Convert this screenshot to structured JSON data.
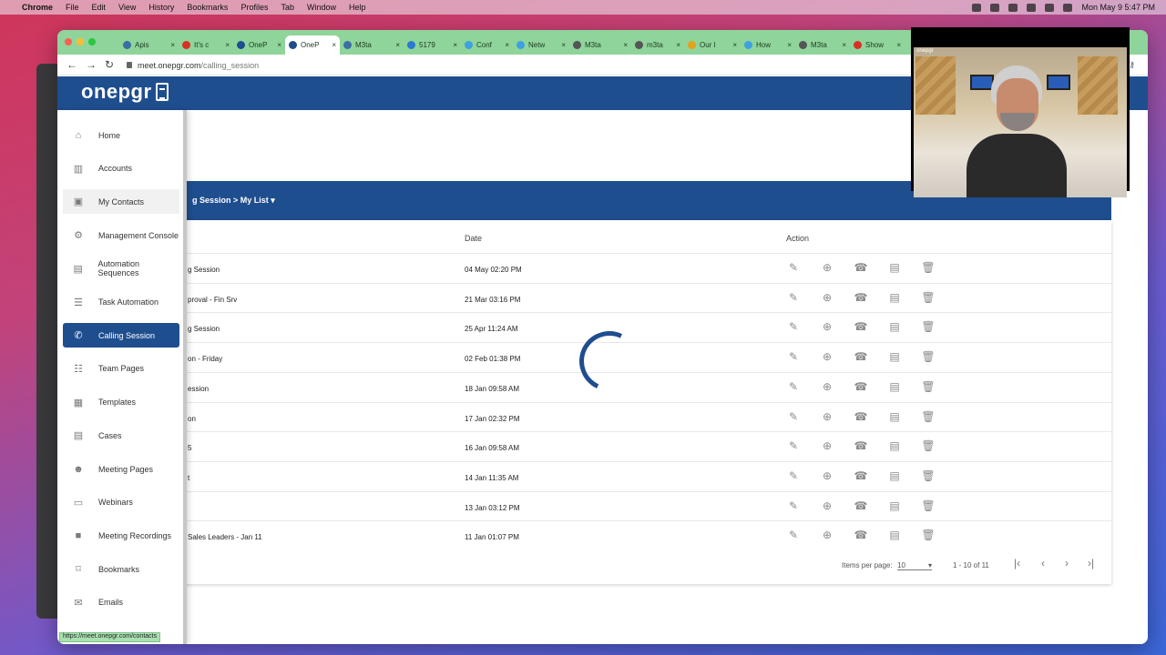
{
  "menubar": {
    "app": "Chrome",
    "items": [
      "File",
      "Edit",
      "View",
      "History",
      "Bookmarks",
      "Profiles",
      "Tab",
      "Window",
      "Help"
    ],
    "clock": "Mon May 9  5:47 PM"
  },
  "browser": {
    "tabs": [
      {
        "label": "Apis",
        "color": "#3b6ea5"
      },
      {
        "label": "It's c",
        "color": "#d93025"
      },
      {
        "label": "OneP",
        "color": "#1f4e8f"
      },
      {
        "label": "OneP",
        "color": "#1f4e8f",
        "active": true
      },
      {
        "label": "M3ta",
        "color": "#3b6ea5"
      },
      {
        "label": "5179",
        "color": "#2a7ad2"
      },
      {
        "label": "Conf",
        "color": "#3fa1e0"
      },
      {
        "label": "Netw",
        "color": "#3fa1e0"
      },
      {
        "label": "M3ta",
        "color": "#555"
      },
      {
        "label": "m3ta",
        "color": "#555"
      },
      {
        "label": "Our I",
        "color": "#e3a21a"
      },
      {
        "label": "How",
        "color": "#3fa1e0"
      },
      {
        "label": "M3ta",
        "color": "#555"
      },
      {
        "label": "Show",
        "color": "#d93025"
      }
    ],
    "url_host": "meet.onepgr.com",
    "url_path": "/calling_session",
    "status_url": "https://meet.onepgr.com/contacts"
  },
  "app": {
    "logo": "onepgr",
    "breadcrumb": "g Session  >  My List ▾"
  },
  "sidebar": {
    "items": [
      {
        "label": "Home",
        "icon": "⌂"
      },
      {
        "label": "Accounts",
        "icon": "▥"
      },
      {
        "label": "My Contacts",
        "icon": "▣"
      },
      {
        "label": "Management Console",
        "icon": "⚙"
      },
      {
        "label": "Automation Sequences",
        "icon": "▤"
      },
      {
        "label": "Task Automation",
        "icon": "☰"
      },
      {
        "label": "Calling Session",
        "icon": "✆"
      },
      {
        "label": "Team Pages",
        "icon": "☷"
      },
      {
        "label": "Templates",
        "icon": "▦"
      },
      {
        "label": "Cases",
        "icon": "▤"
      },
      {
        "label": "Meeting Pages",
        "icon": "☻"
      },
      {
        "label": "Webinars",
        "icon": "▭"
      },
      {
        "label": "Meeting Recordings",
        "icon": "■"
      },
      {
        "label": "Bookmarks",
        "icon": "⌑"
      },
      {
        "label": "Emails",
        "icon": "✉"
      }
    ]
  },
  "table": {
    "headers": {
      "date": "Date",
      "action": "Action"
    },
    "rows": [
      {
        "name": "g Session",
        "date": "04 May 02:20 PM"
      },
      {
        "name": "proval - Fin Srv",
        "date": "21 Mar 03:16 PM"
      },
      {
        "name": "g Session",
        "date": "25 Apr 11:24 AM"
      },
      {
        "name": "on - Friday",
        "date": "02 Feb 01:38 PM"
      },
      {
        "name": "ession",
        "date": "18 Jan 09:58 AM"
      },
      {
        "name": "on",
        "date": "17 Jan 02:32 PM"
      },
      {
        "name": "5",
        "date": "16 Jan 09:58 AM"
      },
      {
        "name": "t",
        "date": "14 Jan 11:35 AM"
      },
      {
        "name": "",
        "date": "13 Jan 03:12 PM"
      },
      {
        "name": "Sales Leaders - Jan 11",
        "date": "11 Jan 01:07 PM"
      }
    ],
    "pager": {
      "label": "Items per page:",
      "per_page": "10",
      "range": "1 - 10 of 11"
    }
  },
  "webcam": {
    "title": "onepgr"
  }
}
